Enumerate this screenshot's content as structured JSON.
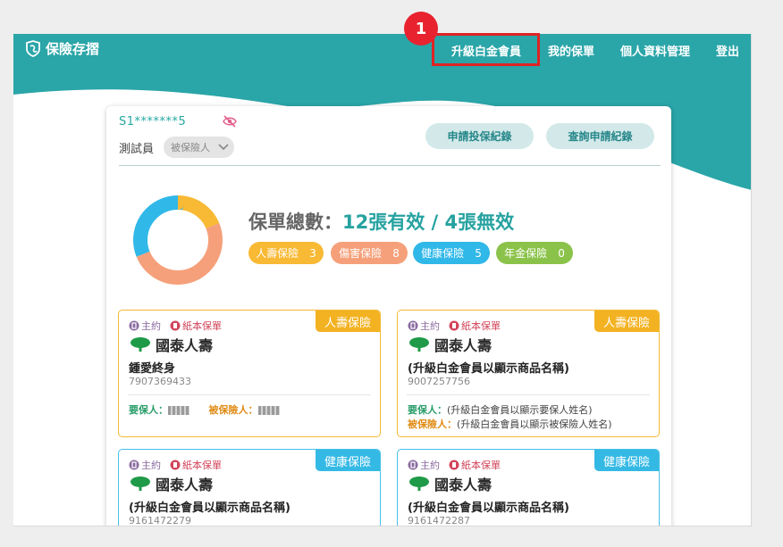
{
  "nav": {
    "logo": "保險存摺",
    "items": [
      "升級白金會員",
      "我的保單",
      "個人資料管理",
      "登出"
    ],
    "step_number": "1"
  },
  "user": {
    "id_masked": "S1*******5",
    "name": "測試員",
    "role": "被保險人"
  },
  "actions": {
    "apply_record": "申請投保紀錄",
    "query_record": "查詢申請紀錄"
  },
  "summary": {
    "label": "保單總數：",
    "valid": "12張有效",
    "separator": " / ",
    "invalid": "4張無效"
  },
  "chart_data": {
    "type": "pie",
    "categories": [
      "人壽保險",
      "傷害保險",
      "健康保險",
      "年金保險"
    ],
    "values": [
      3,
      8,
      5,
      0
    ],
    "colors": [
      "#f8b934",
      "#f5a07a",
      "#30b8e8",
      "#8bc34a"
    ]
  },
  "categories": [
    {
      "label": "人壽保險",
      "count": "3",
      "color": "#f8b934"
    },
    {
      "label": "傷害保險",
      "count": "8",
      "color": "#f5a07a"
    },
    {
      "label": "健康保險",
      "count": "5",
      "color": "#30b8e8"
    },
    {
      "label": "年金保險",
      "count": "0",
      "color": "#8bc34a"
    }
  ],
  "cards": [
    {
      "type": "人壽保險",
      "flag_main": "主約",
      "flag_paper": "紙本保單",
      "company": "國泰人壽",
      "product": "鍾愛終身",
      "policy_no": "7907369433",
      "holder_label": "要保人：",
      "insured_label": "被保險人："
    },
    {
      "type": "人壽保險",
      "flag_main": "主約",
      "flag_paper": "紙本保單",
      "company": "國泰人壽",
      "product": "(升級白金會員以顯示商品名稱)",
      "policy_no": "9007257756",
      "holder_label": "要保人：",
      "holder_value": "(升級白金會員以顯示要保人姓名)",
      "insured_label": "被保險人：",
      "insured_value": "(升級白金會員以顯示被保險人姓名)"
    },
    {
      "type": "健康保險",
      "flag_main": "主約",
      "flag_paper": "紙本保單",
      "company": "國泰人壽",
      "product": "(升級白金會員以顯示商品名稱)",
      "policy_no": "9161472279"
    },
    {
      "type": "健康保險",
      "flag_main": "主約",
      "flag_paper": "紙本保單",
      "company": "國泰人壽",
      "product": "(升級白金會員以顯示商品名稱)",
      "policy_no": "9161472287"
    }
  ],
  "colors": {
    "teal": "#2aa5a8",
    "highlight": "#e02323"
  }
}
